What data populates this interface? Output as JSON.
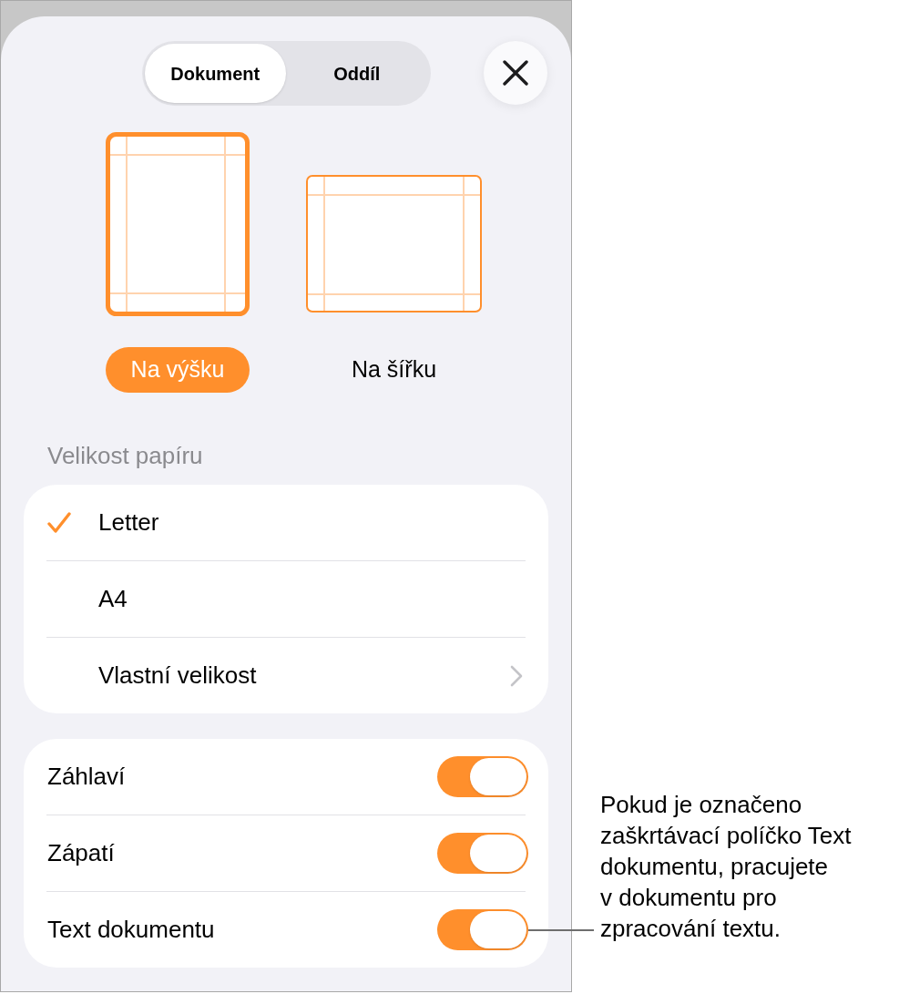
{
  "tabs": [
    {
      "label": "Dokument",
      "selected": true
    },
    {
      "label": "Oddíl",
      "selected": false
    }
  ],
  "orientations": [
    {
      "kind": "portrait",
      "label": "Na výšku",
      "selected": true
    },
    {
      "kind": "landscape",
      "label": "Na šířku",
      "selected": false
    }
  ],
  "paper_size": {
    "heading": "Velikost papíru",
    "options": [
      {
        "kind": "option",
        "label": "Letter",
        "selected": true
      },
      {
        "kind": "option",
        "label": "A4",
        "selected": false
      },
      {
        "kind": "submenu",
        "label": "Vlastní velikost",
        "selected": false
      }
    ]
  },
  "toggles": [
    {
      "label": "Záhlaví",
      "on": true
    },
    {
      "label": "Zápatí",
      "on": true
    },
    {
      "label": "Text dokumentu",
      "on": true
    }
  ],
  "callout": {
    "lines": [
      "Pokud je označeno",
      "zaškrtávací políčko Text",
      "dokumentu, pracujete",
      "v dokumentu pro",
      "zpracování textu."
    ]
  }
}
